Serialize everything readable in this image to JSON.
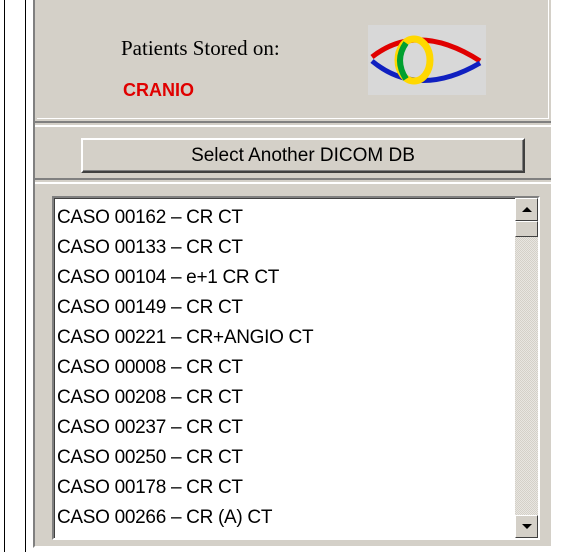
{
  "header": {
    "stored_label": "Patients Stored on:",
    "db_name": "CRANIO",
    "db_name_color": "#e00000",
    "logo_icon": "eye-logo-icon"
  },
  "toolbar": {
    "select_db_label": "Select Another DICOM DB"
  },
  "patients": [
    "CASO 00162 – CR CT",
    "CASO 00133 – CR CT",
    "CASO 00104 – e+1 CR CT",
    "CASO 00149 – CR CT",
    "CASO 00221 – CR+ANGIO CT",
    "CASO 00008 – CR CT",
    "CASO 00208 – CR CT",
    "CASO 00237 – CR CT",
    "CASO 00250 – CR CT",
    "CASO 00178 – CR CT",
    "CASO 00266 – CR (A) CT"
  ],
  "scrollbar": {
    "up_icon": "scroll-up-arrow-icon",
    "down_icon": "scroll-down-arrow-icon"
  }
}
